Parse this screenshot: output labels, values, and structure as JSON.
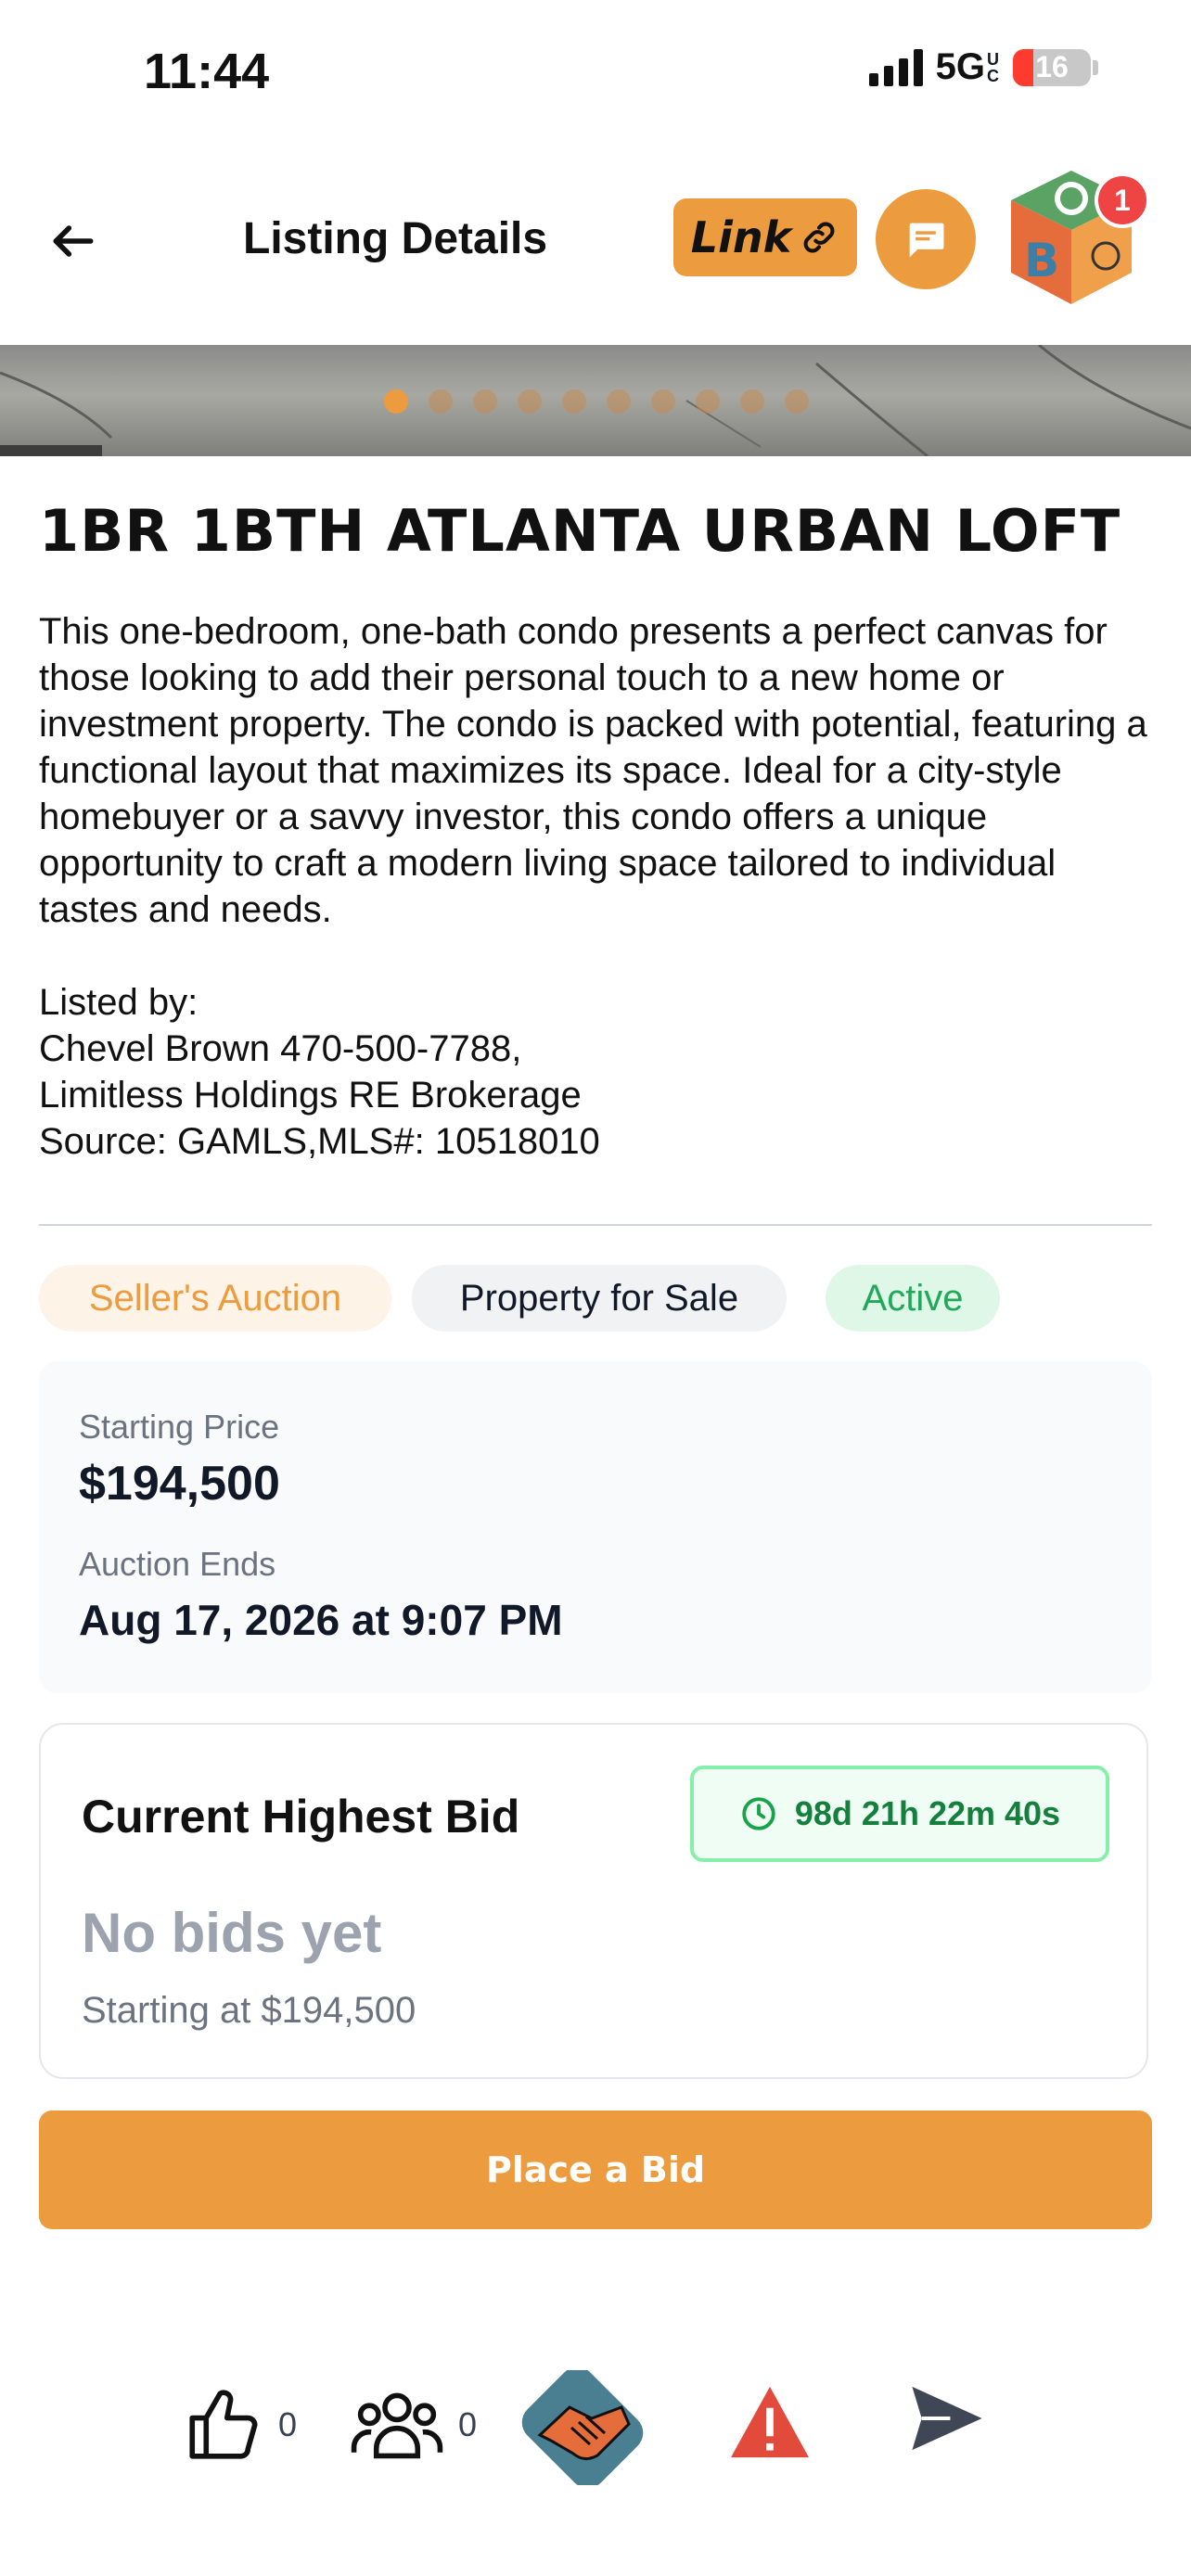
{
  "status_bar": {
    "time": "11:44",
    "network": "5G",
    "network_sub": "UC",
    "battery": "16"
  },
  "header": {
    "title": "Listing Details",
    "link_label": "Link",
    "notification_count": "1"
  },
  "gallery": {
    "dot_count": 10,
    "active_index": 0
  },
  "listing": {
    "title": "1BR 1BTH ATLANTA URBAN LOFT",
    "description": "This one-bedroom, one-bath condo presents a perfect canvas for those looking to add their personal touch to a new home or investment property. The condo is packed with potential, featuring a functional layout that maximizes its space. Ideal for a city-style homebuyer or a savvy investor, this condo offers a unique opportunity to craft a modern living space tailored to individual tastes and needs.\n\nListed by:\nChevel Brown 470-500-7788,\nLimitless Holdings RE Brokerage\nSource: GAMLS,MLS#: 10518010"
  },
  "tags": {
    "auction": "Seller's Auction",
    "type": "Property for Sale",
    "status": "Active"
  },
  "pricing": {
    "starting_label": "Starting Price",
    "starting_value": "$194,500",
    "ends_label": "Auction Ends",
    "ends_value": "Aug 17, 2026 at 9:07 PM"
  },
  "bid": {
    "title": "Current Highest Bid",
    "timer": "98d 21h 22m 40s",
    "no_bids": "No bids yet",
    "starting_at": "Starting at $194,500",
    "button": "Place a Bid"
  },
  "actions": {
    "likes": "0",
    "followers": "0"
  },
  "colors": {
    "accent": "#ec9b3e",
    "success": "#22a85a",
    "danger": "#e24a3b"
  }
}
